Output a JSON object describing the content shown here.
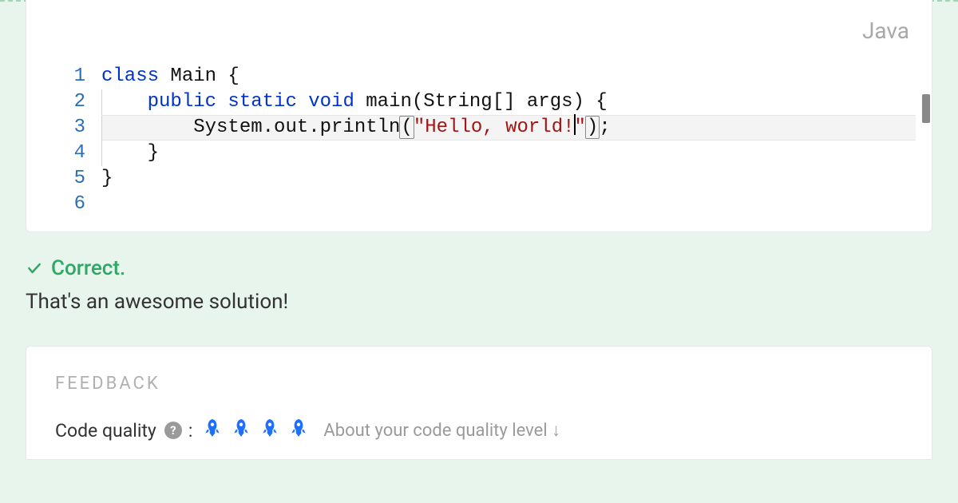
{
  "editor": {
    "language": "Java",
    "lineNumbers": [
      "1",
      "2",
      "3",
      "4",
      "5",
      "6"
    ],
    "lines": {
      "l1_kw": "class",
      "l1_rest": " Main {",
      "l2_kw": "public static void",
      "l2_rest": " main(String[] args) {",
      "l3_call": "System.out.println",
      "l3_open": "(",
      "l3_str1": "\"Hello, world!",
      "l3_str2": "\"",
      "l3_close": ")",
      "l3_semi": ";",
      "l4": "}",
      "l5": "}",
      "l6": ""
    }
  },
  "result": {
    "status": "Correct.",
    "message": "That's an awesome solution!"
  },
  "feedback": {
    "title": "FEEDBACK",
    "quality_label": "Code quality",
    "colon": " :",
    "rocketCount": 4,
    "about_text": "About your code quality level ↓"
  }
}
